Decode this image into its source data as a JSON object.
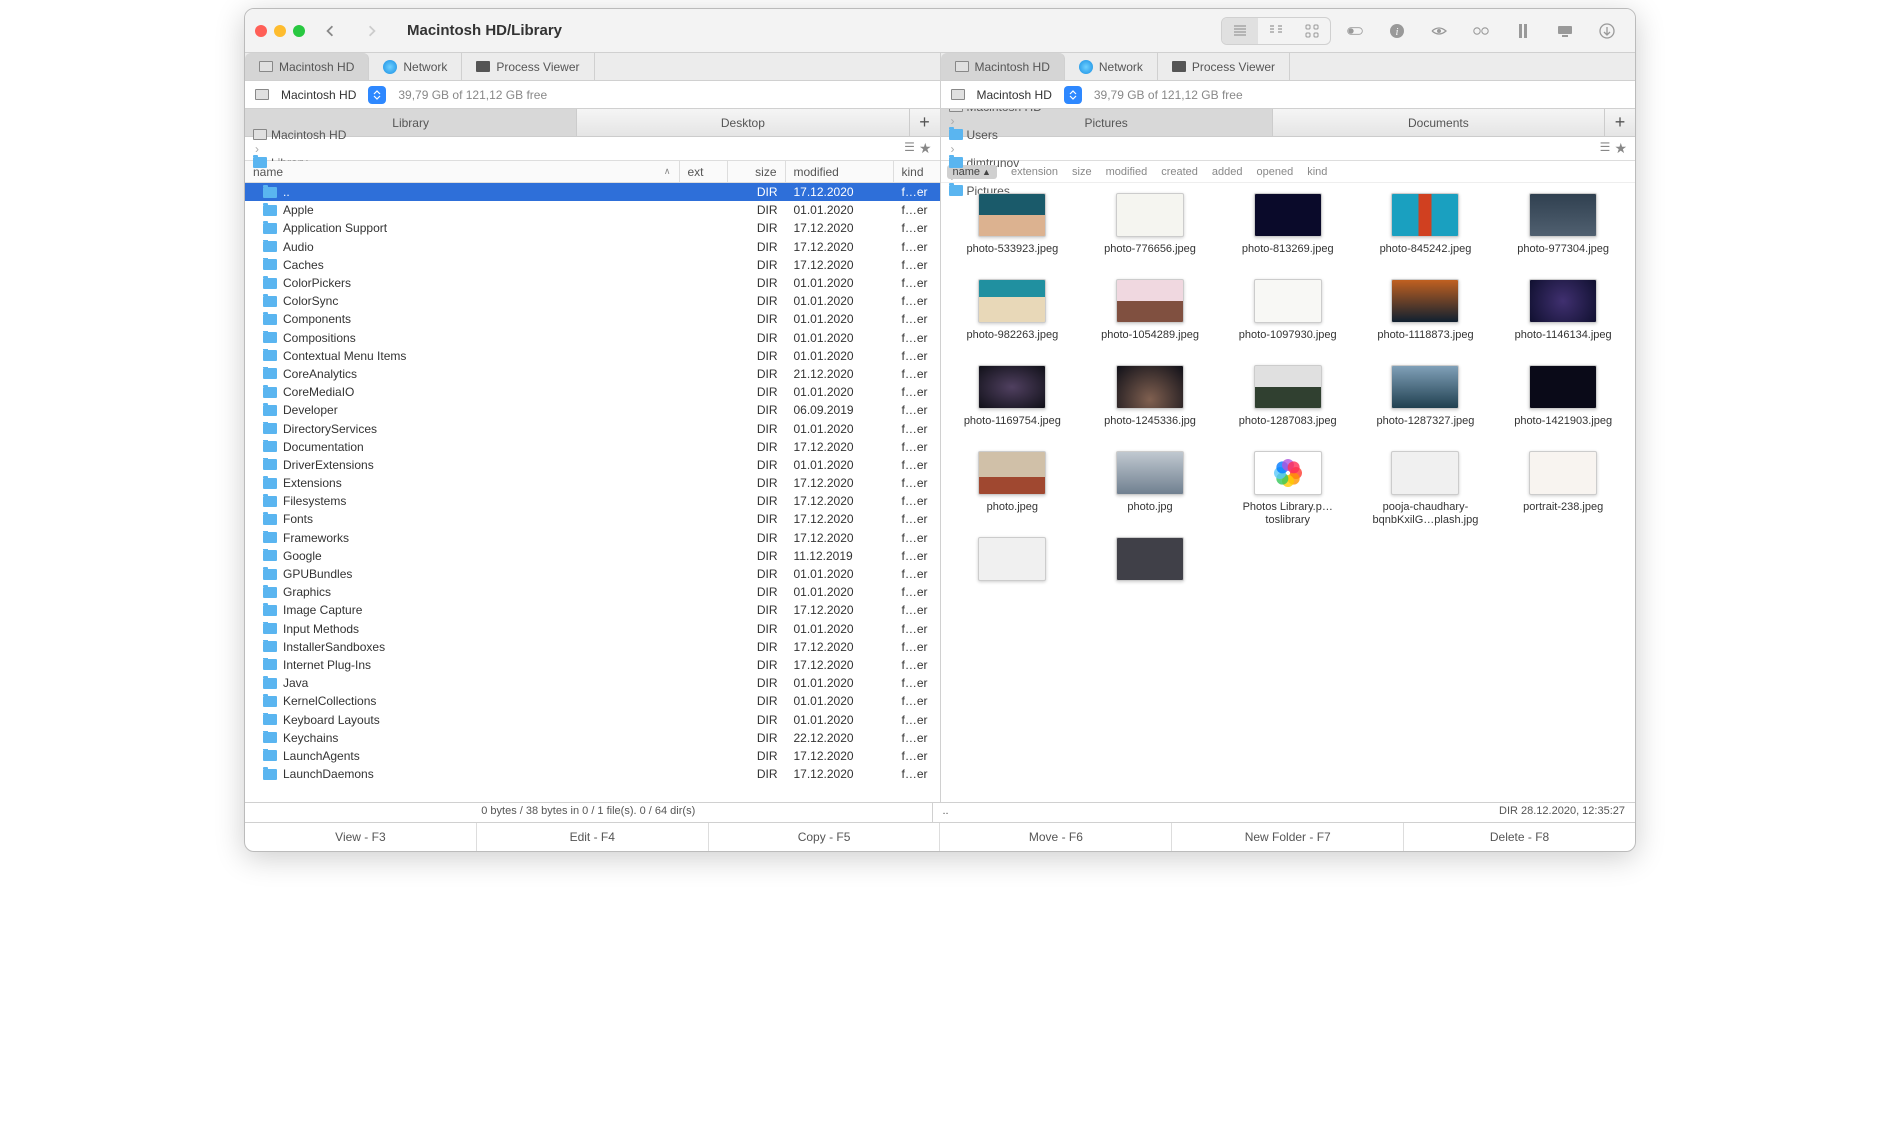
{
  "window": {
    "title": "Macintosh HD/Library"
  },
  "toolbar": {
    "views": [
      "list-view",
      "column-view",
      "icon-view"
    ],
    "tools": [
      "darkmode",
      "info",
      "quicklook",
      "binoculars",
      "terminal",
      "desktop",
      "eject"
    ]
  },
  "location_tabs_left": [
    {
      "icon": "hd",
      "label": "Macintosh HD",
      "active": true
    },
    {
      "icon": "globe",
      "label": "Network"
    },
    {
      "icon": "monitor",
      "label": "Process Viewer"
    }
  ],
  "location_tabs_right": [
    {
      "icon": "hd",
      "label": "Macintosh HD",
      "active": true
    },
    {
      "icon": "globe",
      "label": "Network"
    },
    {
      "icon": "monitor",
      "label": "Process Viewer"
    }
  ],
  "drive_left": {
    "name": "Macintosh HD",
    "free": "39,79 GB of 121,12 GB free"
  },
  "drive_right": {
    "name": "Macintosh HD",
    "free": "39,79 GB of 121,12 GB free"
  },
  "pane_left": {
    "tabs": [
      {
        "label": "Library",
        "active": true
      },
      {
        "label": "Desktop"
      }
    ],
    "breadcrumb": [
      {
        "icon": "hd",
        "label": "Macintosh HD"
      },
      {
        "icon": "folder",
        "label": "Library"
      }
    ],
    "columns": [
      "name",
      "ext",
      "size",
      "modified",
      "kind"
    ],
    "rows": [
      {
        "name": "..",
        "ext": "",
        "size": "DIR",
        "modified": "17.12.2020",
        "kind": "f…er",
        "selected": true
      },
      {
        "name": "Apple",
        "ext": "",
        "size": "DIR",
        "modified": "01.01.2020",
        "kind": "f…er"
      },
      {
        "name": "Application Support",
        "ext": "",
        "size": "DIR",
        "modified": "17.12.2020",
        "kind": "f…er"
      },
      {
        "name": "Audio",
        "ext": "",
        "size": "DIR",
        "modified": "17.12.2020",
        "kind": "f…er"
      },
      {
        "name": "Caches",
        "ext": "",
        "size": "DIR",
        "modified": "17.12.2020",
        "kind": "f…er"
      },
      {
        "name": "ColorPickers",
        "ext": "",
        "size": "DIR",
        "modified": "01.01.2020",
        "kind": "f…er"
      },
      {
        "name": "ColorSync",
        "ext": "",
        "size": "DIR",
        "modified": "01.01.2020",
        "kind": "f…er"
      },
      {
        "name": "Components",
        "ext": "",
        "size": "DIR",
        "modified": "01.01.2020",
        "kind": "f…er"
      },
      {
        "name": "Compositions",
        "ext": "",
        "size": "DIR",
        "modified": "01.01.2020",
        "kind": "f…er"
      },
      {
        "name": "Contextual Menu Items",
        "ext": "",
        "size": "DIR",
        "modified": "01.01.2020",
        "kind": "f…er"
      },
      {
        "name": "CoreAnalytics",
        "ext": "",
        "size": "DIR",
        "modified": "21.12.2020",
        "kind": "f…er"
      },
      {
        "name": "CoreMediaIO",
        "ext": "",
        "size": "DIR",
        "modified": "01.01.2020",
        "kind": "f…er"
      },
      {
        "name": "Developer",
        "ext": "",
        "size": "DIR",
        "modified": "06.09.2019",
        "kind": "f…er"
      },
      {
        "name": "DirectoryServices",
        "ext": "",
        "size": "DIR",
        "modified": "01.01.2020",
        "kind": "f…er"
      },
      {
        "name": "Documentation",
        "ext": "",
        "size": "DIR",
        "modified": "17.12.2020",
        "kind": "f…er"
      },
      {
        "name": "DriverExtensions",
        "ext": "",
        "size": "DIR",
        "modified": "01.01.2020",
        "kind": "f…er"
      },
      {
        "name": "Extensions",
        "ext": "",
        "size": "DIR",
        "modified": "17.12.2020",
        "kind": "f…er"
      },
      {
        "name": "Filesystems",
        "ext": "",
        "size": "DIR",
        "modified": "17.12.2020",
        "kind": "f…er"
      },
      {
        "name": "Fonts",
        "ext": "",
        "size": "DIR",
        "modified": "17.12.2020",
        "kind": "f…er"
      },
      {
        "name": "Frameworks",
        "ext": "",
        "size": "DIR",
        "modified": "17.12.2020",
        "kind": "f…er"
      },
      {
        "name": "Google",
        "ext": "",
        "size": "DIR",
        "modified": "11.12.2019",
        "kind": "f…er"
      },
      {
        "name": "GPUBundles",
        "ext": "",
        "size": "DIR",
        "modified": "01.01.2020",
        "kind": "f…er"
      },
      {
        "name": "Graphics",
        "ext": "",
        "size": "DIR",
        "modified": "01.01.2020",
        "kind": "f…er"
      },
      {
        "name": "Image Capture",
        "ext": "",
        "size": "DIR",
        "modified": "17.12.2020",
        "kind": "f…er"
      },
      {
        "name": "Input Methods",
        "ext": "",
        "size": "DIR",
        "modified": "01.01.2020",
        "kind": "f…er"
      },
      {
        "name": "InstallerSandboxes",
        "ext": "",
        "size": "DIR",
        "modified": "17.12.2020",
        "kind": "f…er"
      },
      {
        "name": "Internet Plug-Ins",
        "ext": "",
        "size": "DIR",
        "modified": "17.12.2020",
        "kind": "f…er"
      },
      {
        "name": "Java",
        "ext": "",
        "size": "DIR",
        "modified": "01.01.2020",
        "kind": "f…er"
      },
      {
        "name": "KernelCollections",
        "ext": "",
        "size": "DIR",
        "modified": "01.01.2020",
        "kind": "f…er"
      },
      {
        "name": "Keyboard Layouts",
        "ext": "",
        "size": "DIR",
        "modified": "01.01.2020",
        "kind": "f…er"
      },
      {
        "name": "Keychains",
        "ext": "",
        "size": "DIR",
        "modified": "22.12.2020",
        "kind": "f…er"
      },
      {
        "name": "LaunchAgents",
        "ext": "",
        "size": "DIR",
        "modified": "17.12.2020",
        "kind": "f…er"
      },
      {
        "name": "LaunchDaemons",
        "ext": "",
        "size": "DIR",
        "modified": "17.12.2020",
        "kind": "f…er"
      }
    ]
  },
  "pane_right": {
    "tabs": [
      {
        "label": "Pictures",
        "active": true
      },
      {
        "label": "Documents"
      }
    ],
    "breadcrumb": [
      {
        "icon": "hd",
        "label": "Macintosh HD"
      },
      {
        "icon": "folder",
        "label": "Users"
      },
      {
        "icon": "folder",
        "label": "dimtrunov"
      },
      {
        "icon": "folder",
        "label": "Pictures"
      }
    ],
    "sort_headers": [
      "name",
      "extension",
      "size",
      "modified",
      "created",
      "added",
      "opened",
      "kind"
    ],
    "sort_active": "name",
    "thumbs": [
      {
        "label": "photo-533923.jpeg",
        "bg": "linear-gradient(#1a5a6a 50%,#dcb290 50%)"
      },
      {
        "label": "photo-776656.jpeg",
        "bg": "#f5f5f0"
      },
      {
        "label": "photo-813269.jpeg",
        "bg": "#0a0a2a"
      },
      {
        "label": "photo-845242.jpeg",
        "bg": "linear-gradient(90deg,#1aa0c0 40%,#d04020 40%,#d04020 60%,#1aa0c0 60%)"
      },
      {
        "label": "photo-977304.jpeg",
        "bg": "linear-gradient(#304050,#506070)"
      },
      {
        "label": "photo-982263.jpeg",
        "bg": "linear-gradient(#2090a0 40%,#e8d8b8 40%)"
      },
      {
        "label": "photo-1054289.jpeg",
        "bg": "linear-gradient(#f0d8e0 50%,#805040 50%)"
      },
      {
        "label": "photo-1097930.jpeg",
        "bg": "#f8f8f5"
      },
      {
        "label": "photo-1118873.jpeg",
        "bg": "linear-gradient(#c06020,#102030)"
      },
      {
        "label": "photo-1146134.jpeg",
        "bg": "radial-gradient(circle,#403070,#101030)"
      },
      {
        "label": "photo-1169754.jpeg",
        "bg": "radial-gradient(ellipse at center,#504060,#101018)"
      },
      {
        "label": "photo-1245336.jpg",
        "bg": "radial-gradient(circle at 50% 80%,#806050,#101018)"
      },
      {
        "label": "photo-1287083.jpeg",
        "bg": "linear-gradient(#e0e0e0 50%,#304030 50%)"
      },
      {
        "label": "photo-1287327.jpeg",
        "bg": "linear-gradient(#80a0b8,#204050)"
      },
      {
        "label": "photo-1421903.jpeg",
        "bg": "#0a0a18"
      },
      {
        "label": "photo.jpeg",
        "bg": "linear-gradient(#d0c0a8 60%,#a04830 60%)"
      },
      {
        "label": "photo.jpg",
        "bg": "linear-gradient(#c0c8d0,#708090)"
      },
      {
        "label": "Photos Library.p…toslibrary",
        "bg": "#fff",
        "icon": "photos"
      },
      {
        "label": "pooja-chaudhary-bqnbKxilG…plash.jpg",
        "bg": "#f0f0f0"
      },
      {
        "label": "portrait-238.jpeg",
        "bg": "#f8f4f0"
      },
      {
        "label": "",
        "bg": "#f0f0f0",
        "noLabel": true
      },
      {
        "label": "",
        "bg": "#404048",
        "noLabel": true
      }
    ]
  },
  "status": {
    "left": "0 bytes / 38 bytes in 0 / 1 file(s). 0 / 64 dir(s)",
    "right_path": "..",
    "right_info": "DIR   28.12.2020, 12:35:27"
  },
  "fkeys": [
    "View - F3",
    "Edit - F4",
    "Copy - F5",
    "Move - F6",
    "New Folder - F7",
    "Delete - F8"
  ]
}
